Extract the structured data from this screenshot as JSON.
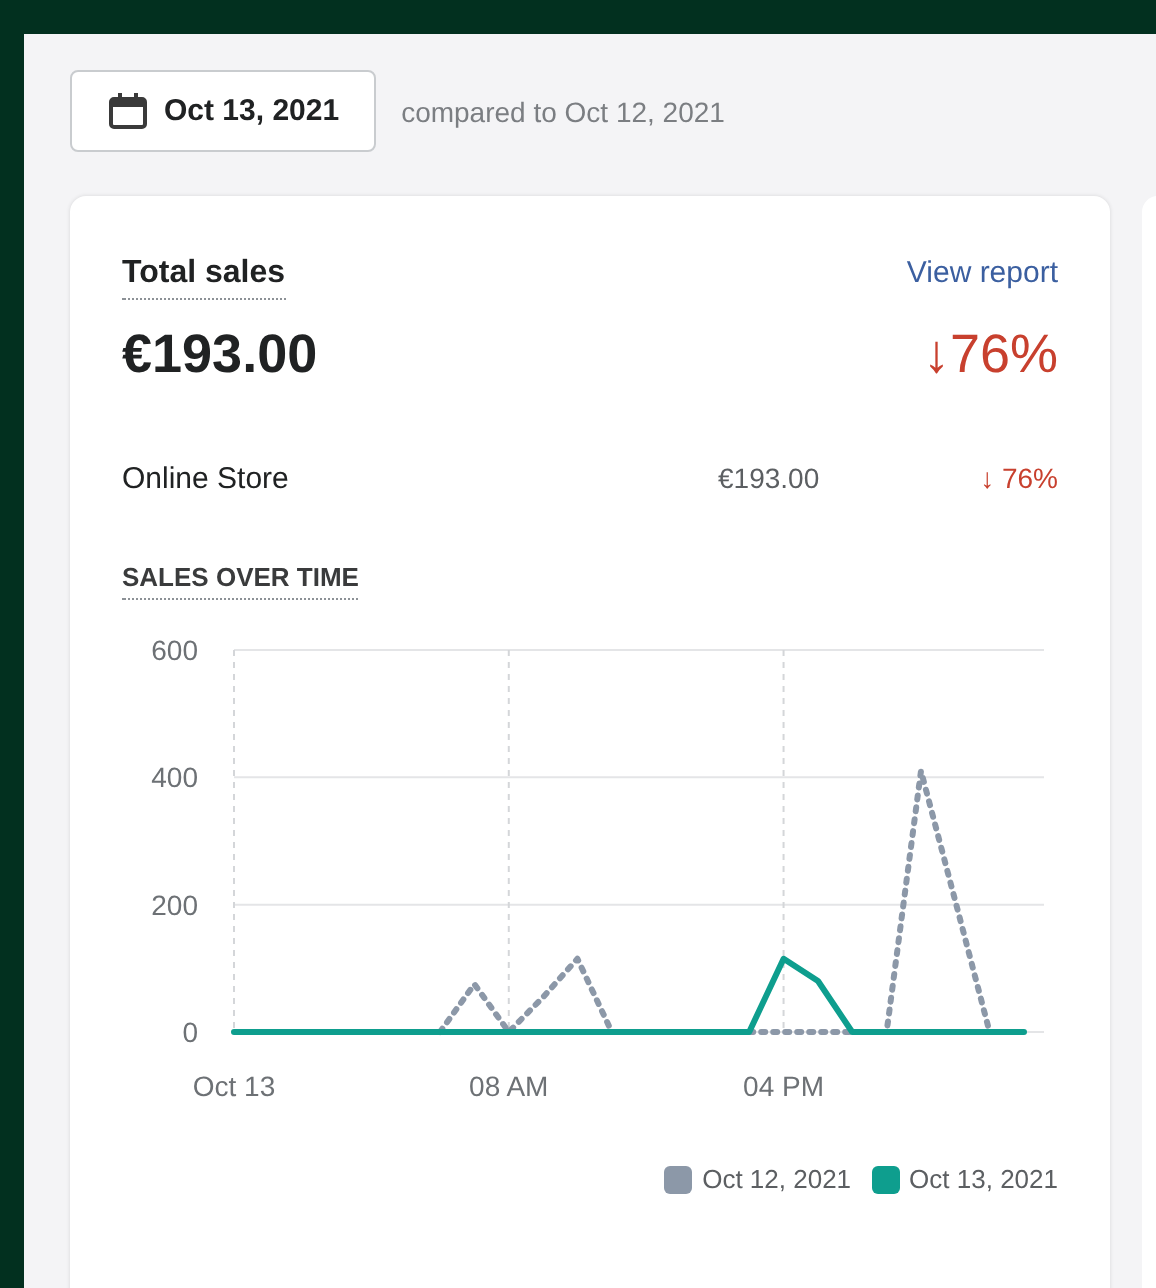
{
  "date_button": {
    "label": "Oct 13, 2021"
  },
  "comparison": "compared to Oct 12, 2021",
  "card": {
    "title": "Total sales",
    "link": "View report",
    "total": "€193.00",
    "change": "↓76%",
    "breakdown": [
      {
        "channel": "Online Store",
        "amount": "€193.00",
        "change": "↓ 76%"
      }
    ],
    "chart_title": "SALES OVER TIME",
    "chart_data": {
      "type": "line",
      "x": [
        "Oct 13",
        null,
        null,
        null,
        null,
        null,
        null,
        null,
        "08 AM",
        null,
        null,
        null,
        null,
        null,
        null,
        null,
        "04 PM",
        null,
        null,
        null,
        null,
        null,
        null,
        null
      ],
      "ylim": [
        0,
        600
      ],
      "yticks": [
        0,
        200,
        400,
        600
      ],
      "grid": true,
      "series": [
        {
          "name": "Oct 12, 2021",
          "color": "#8c98a8",
          "line_style": "dotted",
          "values": [
            null,
            null,
            null,
            null,
            null,
            null,
            0,
            75,
            0,
            55,
            115,
            0,
            null,
            null,
            null,
            0,
            0,
            0,
            0,
            0,
            410,
            205,
            0,
            null
          ]
        },
        {
          "name": "Oct 13, 2021",
          "color": "#0e9e8e",
          "line_style": "solid",
          "values": [
            0,
            0,
            0,
            0,
            0,
            0,
            0,
            0,
            0,
            0,
            0,
            0,
            0,
            0,
            0,
            0,
            115,
            80,
            0,
            0,
            0,
            0,
            0,
            0
          ]
        }
      ]
    }
  }
}
